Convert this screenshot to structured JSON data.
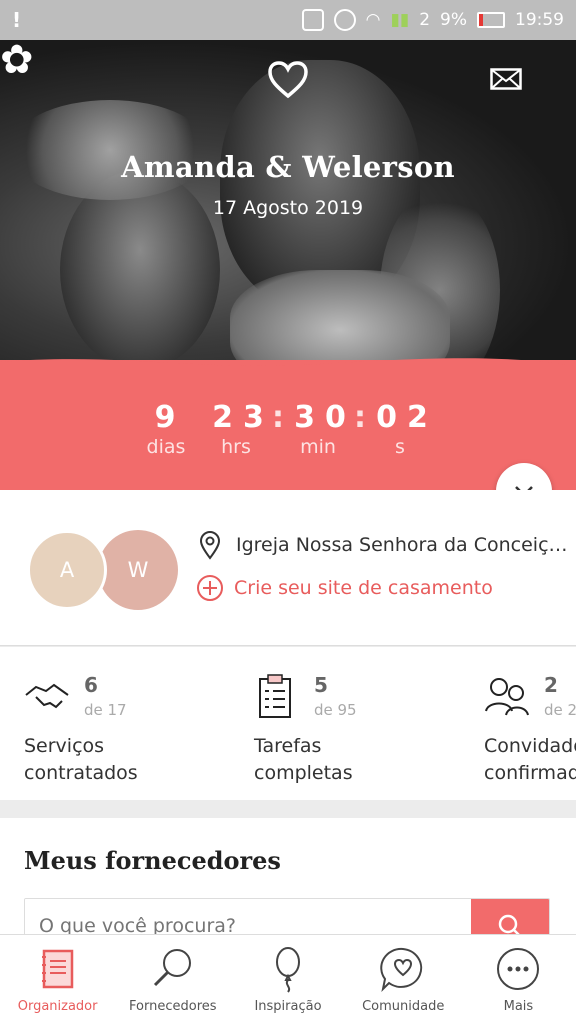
{
  "status_bar": {
    "signal_label": "2",
    "battery": "9%",
    "time": "19:59"
  },
  "hero": {
    "names": "Amanda & Welerson",
    "date": "17 Agosto 2019"
  },
  "countdown": {
    "days": "9",
    "days_label": "dias",
    "hours": "23",
    "hours_label": "hrs",
    "minutes": "30",
    "minutes_label": "min",
    "seconds": "02",
    "seconds_label": "s",
    "separator": ":"
  },
  "couple": {
    "avatar_a": "A",
    "avatar_w": "W",
    "venue": "Igreja Nossa Senhora da Conceiç…",
    "create_site": "Crie seu site de casamento"
  },
  "stats": [
    {
      "num": "6",
      "of": "de 17",
      "label_line1": "Serviços",
      "label_line2": "contratados"
    },
    {
      "num": "5",
      "of": "de 95",
      "label_line1": "Tarefas",
      "label_line2": "completas"
    },
    {
      "num": "2",
      "of": "de 2",
      "label_line1": "Convidados",
      "label_line2": "confirmados"
    }
  ],
  "providers": {
    "title": "Meus fornecedores",
    "search_placeholder": "O que você procura?"
  },
  "nav": [
    {
      "label": "Organizador",
      "icon": "notebook-icon"
    },
    {
      "label": "Fornecedores",
      "icon": "search-icon"
    },
    {
      "label": "Inspiração",
      "icon": "balloon-icon"
    },
    {
      "label": "Comunidade",
      "icon": "chat-heart-icon"
    },
    {
      "label": "Mais",
      "icon": "more-icon"
    }
  ],
  "colors": {
    "accent": "#f26b6b",
    "accent_text": "#e85c5c",
    "status_bar": "#bdbdbd"
  }
}
